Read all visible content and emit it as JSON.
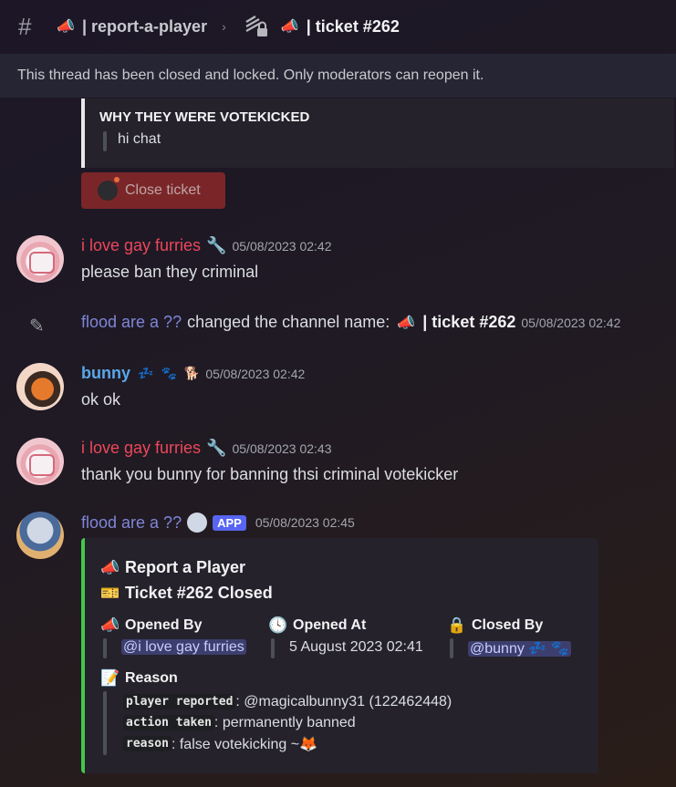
{
  "header": {
    "channel_emoji": "📣",
    "channel_name": "| report-a-player",
    "separator": "›",
    "thread_emoji": "📣",
    "thread_name": "| ticket #262"
  },
  "banner": {
    "text": "This thread has been closed and locked. Only moderators can reopen it."
  },
  "top_embed": {
    "field_name": "WHY THEY WERE VOTEKICKED",
    "field_value": "hi chat"
  },
  "close_button": {
    "label": "Close ticket"
  },
  "messages": [
    {
      "author": "i love gay furries",
      "author_icon": "🔧",
      "timestamp": "05/08/2023 02:42",
      "text": "please ban they criminal"
    },
    {
      "author": "bunny",
      "badges": [
        "💤",
        "🐾",
        "🐕"
      ],
      "timestamp": "05/08/2023 02:42",
      "text": "ok ok"
    },
    {
      "author": "i love gay furries",
      "author_icon": "🔧",
      "timestamp": "05/08/2023 02:43",
      "text": "thank you bunny for banning thsi  criminal votekicker"
    },
    {
      "author": "flood are a ??",
      "app_badge": "APP",
      "timestamp": "05/08/2023 02:45"
    }
  ],
  "system_message": {
    "author": "flood are a ??",
    "text": "changed the channel name:",
    "emoji": "📣",
    "new_name": "| ticket #262",
    "timestamp": "05/08/2023 02:42"
  },
  "main_embed": {
    "title_emoji": "📣",
    "title": "Report a Player",
    "subtitle_emoji": "🎫",
    "subtitle": "Ticket #262 Closed",
    "fields": [
      {
        "emoji": "📣",
        "name": "Opened By",
        "value": "@i love gay furries",
        "mention": true
      },
      {
        "emoji": "🕓",
        "name": "Opened At",
        "value": "5 August 2023 02:41",
        "mention": false
      },
      {
        "emoji": "🔒",
        "name": "Closed By",
        "value": "@bunny 💤 🐾",
        "mention": true
      }
    ],
    "reason": {
      "emoji": "📝",
      "name": "Reason",
      "lines": [
        {
          "key": "player reported",
          "value": ": @magicalbunny31 (122462448)"
        },
        {
          "key": "action taken",
          "value": ": permanently banned"
        },
        {
          "key": "reason",
          "value": ": false votekicking ~🦊"
        }
      ]
    }
  }
}
